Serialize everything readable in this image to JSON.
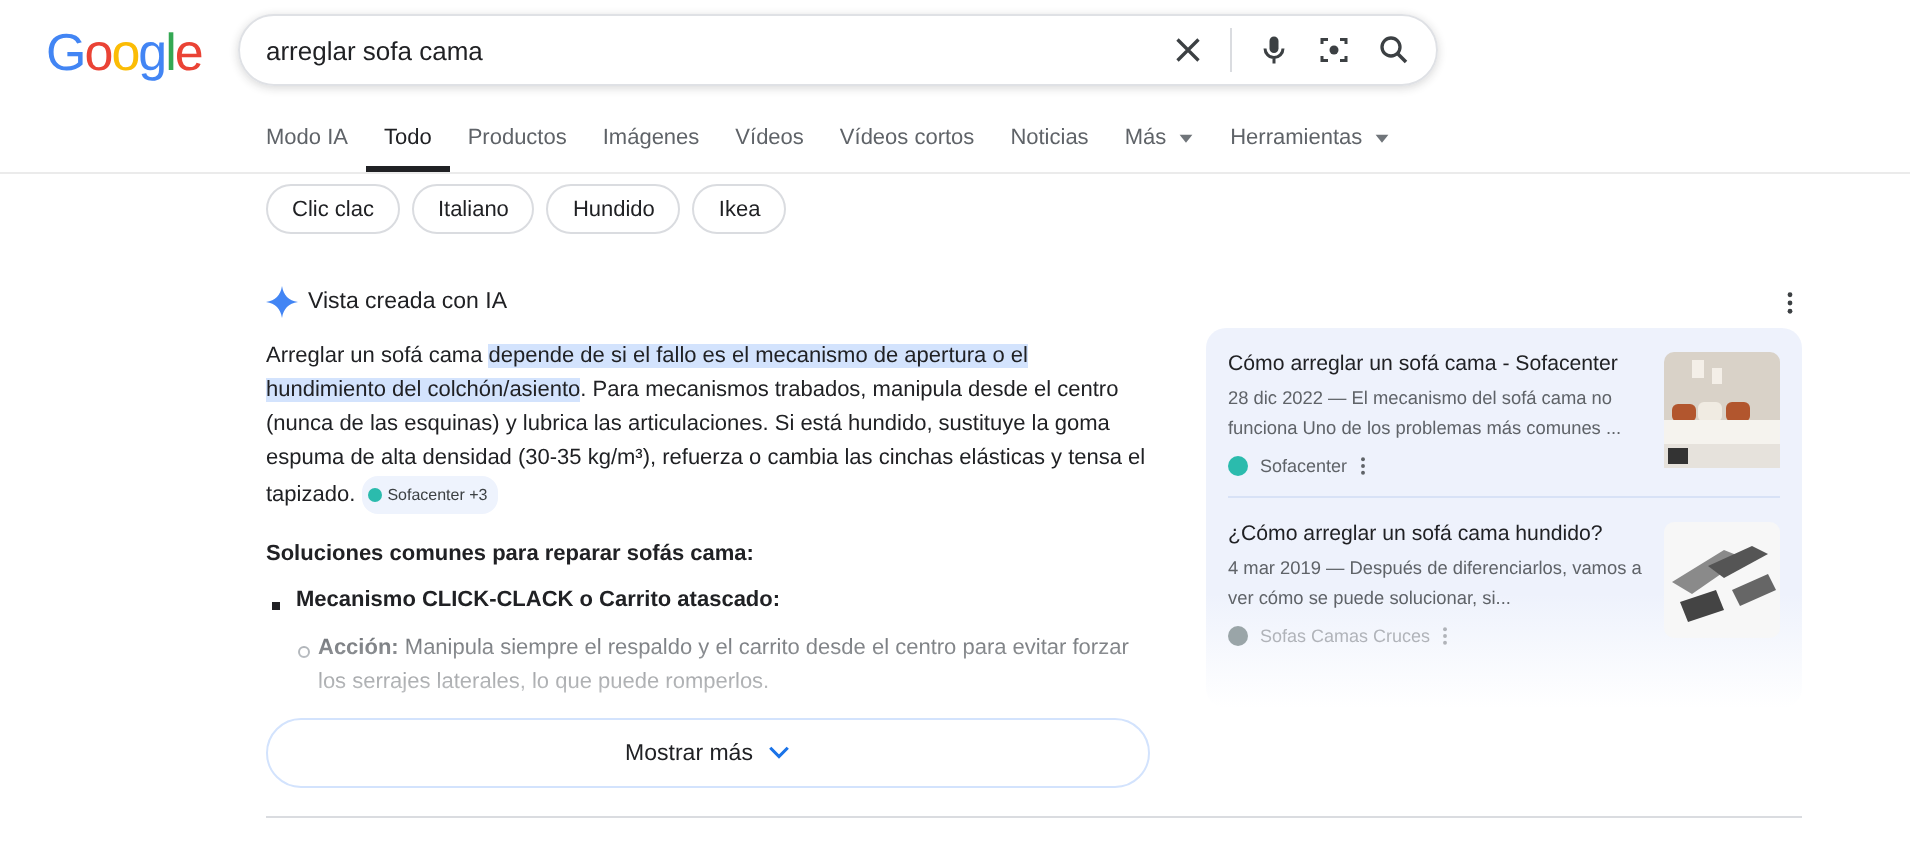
{
  "logo": "Google",
  "search": {
    "value": "arreglar sofa cama"
  },
  "tabs": [
    {
      "label": "Modo IA",
      "selected": false,
      "dropdown": false
    },
    {
      "label": "Todo",
      "selected": true,
      "dropdown": false
    },
    {
      "label": "Productos",
      "selected": false,
      "dropdown": false
    },
    {
      "label": "Imágenes",
      "selected": false,
      "dropdown": false
    },
    {
      "label": "Vídeos",
      "selected": false,
      "dropdown": false
    },
    {
      "label": "Vídeos cortos",
      "selected": false,
      "dropdown": false
    },
    {
      "label": "Noticias",
      "selected": false,
      "dropdown": false
    },
    {
      "label": "Más",
      "selected": false,
      "dropdown": true
    },
    {
      "label": "Herramientas",
      "selected": false,
      "dropdown": true
    }
  ],
  "chips": [
    "Clic clac",
    "Italiano",
    "Hundido",
    "Ikea"
  ],
  "ai_overview": {
    "header": "Vista creada con IA",
    "paragraph": {
      "before": "Arreglar un sofá cama ",
      "highlighted": "depende de si el fallo es el mecanismo de apertura o el hundimiento del colchón/asiento",
      "after": ". Para mecanismos trabados, manipula desde el centro (nunca de las esquinas) y lubrica las articulaciones. Si está hundido, sustituye la goma espuma de alta densidad (30-35 kg/m³), refuerza o cambia las cinchas elásticas y tensa el tapizado."
    },
    "source_chip": {
      "label": "Sofacenter +3",
      "color": "#2bbbad"
    },
    "heading": "Soluciones comunes para reparar sofás cama:",
    "bullets": [
      {
        "text": "Mecanismo CLICK-CLACK o Carrito atascado:",
        "children": [
          {
            "text": "**Acción:** Manipula siempre el respaldo y el carrito desde el centro para evitar forzar los serrajes laterales, lo que puede romperlos."
          }
        ]
      }
    ],
    "show_more": "Mostrar más",
    "sources": [
      {
        "title": "Cómo arreglar un sofá cama - Sofacenter",
        "snippet": "28 dic 2022 — El mecanismo del sofá cama no funciona Uno de los problemas más comunes ...",
        "site": "Sofacenter",
        "color": "#2bbbad",
        "kind": "room"
      },
      {
        "title": "¿Cómo arreglar un sofá cama hundido?",
        "snippet": "4 mar 2019 — Después de diferenciarlos, vamos a ver cómo se puede solucionar, si...",
        "site": "Sofas Camas Cruces",
        "color": "#9aa5a8",
        "kind": "mechanism"
      }
    ]
  }
}
